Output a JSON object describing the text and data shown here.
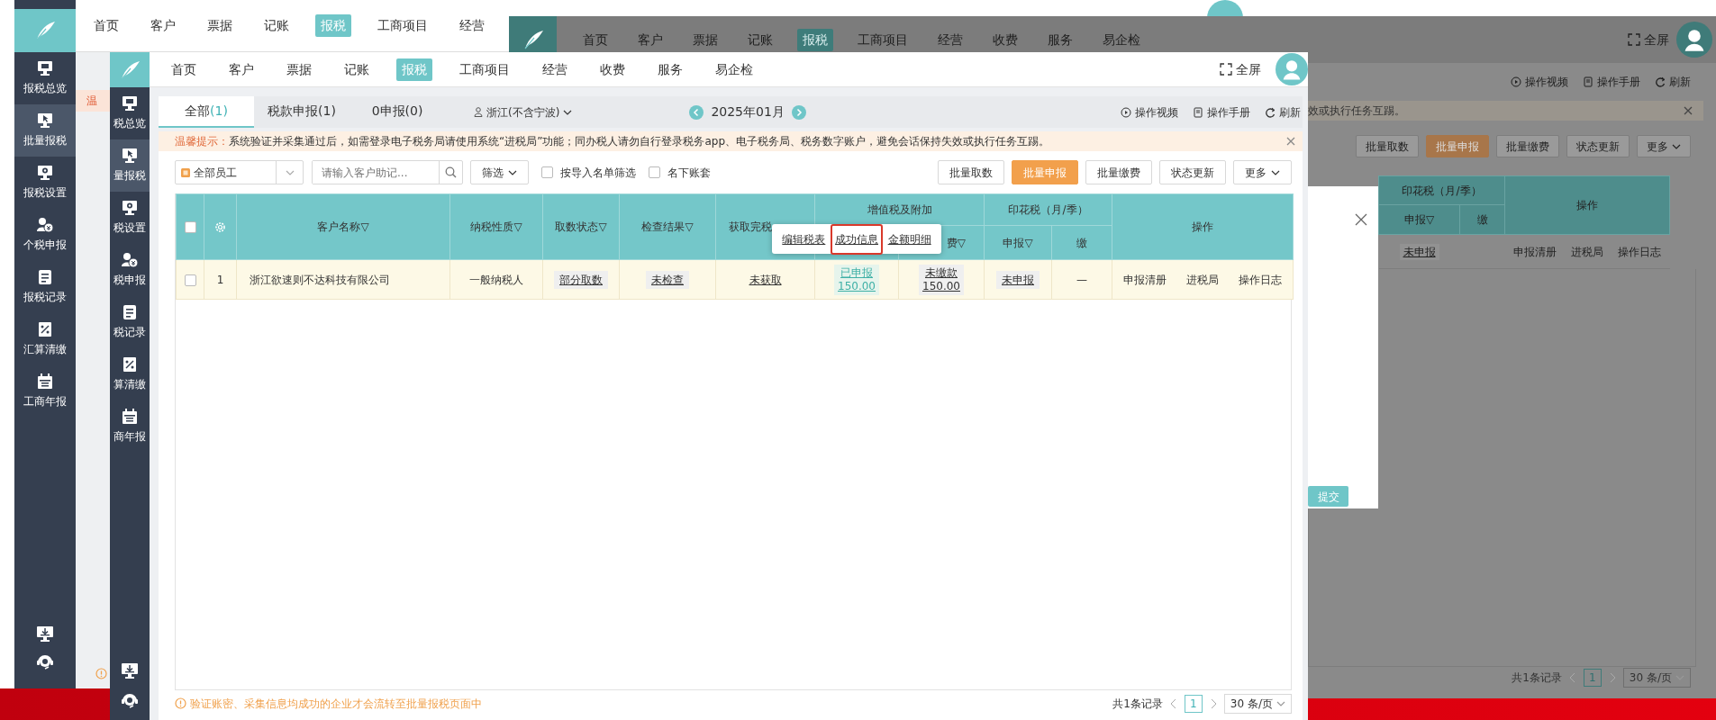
{
  "back_app": {
    "nav": [
      {
        "label": "首页",
        "selected": false
      },
      {
        "label": "客户",
        "selected": false
      },
      {
        "label": "票据",
        "selected": false
      },
      {
        "label": "记账",
        "selected": false
      },
      {
        "label": "报税",
        "selected": true
      },
      {
        "label": "工商项目",
        "selected": false
      },
      {
        "label": "经营",
        "selected": false
      }
    ],
    "sidebar": [
      {
        "label": "报税总览",
        "selected": false
      },
      {
        "label": "批量报税",
        "selected": true
      },
      {
        "label": "报税设置",
        "selected": false
      },
      {
        "label": "个税申报",
        "selected": false
      },
      {
        "label": "报税记录",
        "selected": false
      },
      {
        "label": "汇算清缴",
        "selected": false
      },
      {
        "label": "工商年报",
        "selected": false
      }
    ],
    "notice_fragment": "温"
  },
  "right_app": {
    "nav": [
      {
        "label": "首页",
        "selected": false
      },
      {
        "label": "客户",
        "selected": false
      },
      {
        "label": "票据",
        "selected": false
      },
      {
        "label": "记账",
        "selected": false
      },
      {
        "label": "报税",
        "selected": true
      },
      {
        "label": "工商项目",
        "selected": false
      },
      {
        "label": "经营",
        "selected": false
      },
      {
        "label": "收费",
        "selected": false
      },
      {
        "label": "服务",
        "selected": false
      },
      {
        "label": "易企检",
        "selected": false
      }
    ],
    "fullscreen": "全屏",
    "toolbar": [
      "操作视频",
      "操作手册",
      "刷新"
    ],
    "notice_tail": "效或执行任务互踢。",
    "buttons": [
      {
        "label": "批量取数",
        "primary": false
      },
      {
        "label": "批量申报",
        "primary": true
      },
      {
        "label": "批量缴费",
        "primary": false
      },
      {
        "label": "状态更新",
        "primary": false
      },
      {
        "label": "更多",
        "primary": false
      }
    ],
    "table": {
      "group": "印花税（月/季）",
      "sub_columns": [
        "申报▽",
        "缴"
      ],
      "actions_header": "操作",
      "row": {
        "status": "未申报",
        "actions": [
          "申报清册",
          "进税局",
          "操作日志"
        ]
      }
    },
    "modal": {
      "submit": "提交"
    },
    "pagination": {
      "total": "共1条记录",
      "page": "1",
      "page_size": "30 条/页"
    }
  },
  "main_app": {
    "nav": [
      {
        "label": "首页",
        "selected": false
      },
      {
        "label": "客户",
        "selected": false
      },
      {
        "label": "票据",
        "selected": false
      },
      {
        "label": "记账",
        "selected": false
      },
      {
        "label": "报税",
        "selected": true
      },
      {
        "label": "工商项目",
        "selected": false
      },
      {
        "label": "经营",
        "selected": false
      },
      {
        "label": "收费",
        "selected": false
      },
      {
        "label": "服务",
        "selected": false
      },
      {
        "label": "易企检",
        "selected": false
      }
    ],
    "fullscreen": "全屏",
    "sidebar": [
      {
        "label": "税总览",
        "selected": false
      },
      {
        "label": "量报税",
        "selected": true
      },
      {
        "label": "税设置",
        "selected": false
      },
      {
        "label": "税申报",
        "selected": false
      },
      {
        "label": "税记录",
        "selected": false
      },
      {
        "label": "算清缴",
        "selected": false
      },
      {
        "label": "商年报",
        "selected": false
      }
    ],
    "tabs": [
      {
        "label": "全部",
        "count": "(1)",
        "selected": true
      },
      {
        "label": "税款申报(1)",
        "selected": false
      },
      {
        "label": "0申报(0)",
        "selected": false
      }
    ],
    "region": "浙江(不含宁波)",
    "period": "2025年01月",
    "toolbar": [
      "操作视频",
      "操作手册",
      "刷新"
    ],
    "notice": {
      "label": "温馨提示：",
      "text": "系统验证并采集通过后，如需登录电子税务局请使用系统“进税局”功能；同办税人请勿自行登录税务app、电子税务局、税务数字账户，避免会话保持失效或执行任务互踢。"
    },
    "filters": {
      "staff": "全部员工",
      "search_placeholder": "请输入客户助记...",
      "filter": "筛选",
      "checkboxes": [
        {
          "label": "按导入名单筛选",
          "checked": false
        },
        {
          "label": "名下账套",
          "checked": false
        }
      ]
    },
    "buttons": [
      {
        "label": "批量取数",
        "primary": false
      },
      {
        "label": "批量申报",
        "primary": true
      },
      {
        "label": "批量缴费",
        "primary": false
      },
      {
        "label": "状态更新",
        "primary": false
      },
      {
        "label": "更多",
        "primary": false
      }
    ],
    "table": {
      "columns": [
        {
          "kind": "checkbox",
          "checked": false
        },
        {
          "kind": "settings"
        },
        {
          "kind": "text",
          "label": "客户名称▽"
        },
        {
          "kind": "text",
          "label": "纳税性质▽"
        },
        {
          "kind": "text",
          "label": "取数状态▽"
        },
        {
          "kind": "text",
          "label": "检查结果▽"
        },
        {
          "kind": "text",
          "label": "获取完税"
        },
        {
          "kind": "covered"
        },
        {
          "kind": "sub",
          "label": "费▽"
        },
        {
          "kind": "sub",
          "label": "申报▽"
        },
        {
          "kind": "sub",
          "label": "缴"
        },
        {
          "kind": "text",
          "label": "操作"
        }
      ],
      "groups": [
        "增值税及附加",
        "印花税（月/季）"
      ],
      "rows": [
        {
          "cells": [
            {
              "kind": "checkbox",
              "checked": false
            },
            {
              "kind": "text",
              "text": "1"
            },
            {
              "kind": "text",
              "text": "浙江欲速则不达科技有限公司"
            },
            {
              "kind": "text",
              "text": "一般纳税人"
            },
            {
              "kind": "tag",
              "text": "部分取数"
            },
            {
              "kind": "tag",
              "text": "未检查"
            },
            {
              "kind": "link",
              "text": "未获取"
            },
            {
              "kind": "amount",
              "status": "已申报",
              "amount": "150.00",
              "highlighted": true
            },
            {
              "kind": "amount",
              "status": "未缴款",
              "amount": "150.00",
              "highlighted": false
            },
            {
              "kind": "tag",
              "text": "未申报"
            },
            {
              "kind": "text",
              "text": "—"
            },
            {
              "kind": "actions",
              "items": [
                "申报清册",
                "进税局",
                "操作日志"
              ]
            }
          ]
        }
      ]
    },
    "popover": {
      "items": [
        {
          "label": "编辑税表",
          "selected": false
        },
        {
          "label": "成功信息",
          "selected": true
        },
        {
          "label": "金额明细",
          "selected": false
        }
      ]
    },
    "footer_note": "验证账密、采集信息均成功的企业才会流转至批量报税页面中",
    "pagination": {
      "total": "共1条记录",
      "page": "1",
      "page_size": "30 条/页"
    }
  }
}
